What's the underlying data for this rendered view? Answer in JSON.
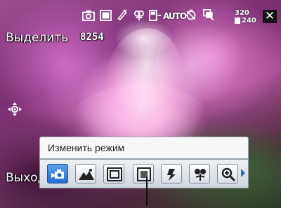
{
  "top_icons": [
    {
      "name": "camera-icon"
    },
    {
      "name": "white-balance-icon"
    },
    {
      "name": "effect-pen-icon"
    },
    {
      "name": "macro-flower-icon"
    },
    {
      "name": "flash-icon"
    },
    {
      "name": "iso-auto-icon",
      "text": "AUTO"
    },
    {
      "name": "timer-off-icon"
    },
    {
      "name": "burst-icon"
    }
  ],
  "resolution": {
    "width": "320",
    "height": "240"
  },
  "left_soft_key": "Выделить",
  "shots_remaining": "8254",
  "right_soft_key": "Выход",
  "mode_menu": {
    "title": "Изменить режим",
    "modes": [
      {
        "name": "video-camera-mode-icon",
        "selected": true
      },
      {
        "name": "landscape-mode-icon",
        "selected": false
      },
      {
        "name": "frame-mode-icon",
        "selected": false
      },
      {
        "name": "picture-mode-icon",
        "selected": false
      },
      {
        "name": "sport-mode-icon",
        "selected": false
      },
      {
        "name": "macro-mode-icon",
        "selected": false
      },
      {
        "name": "zoom-mode-icon",
        "selected": false
      }
    ]
  },
  "colors": {
    "accent": "#1f6fd3",
    "menu_bg": "#f7f7f7"
  }
}
